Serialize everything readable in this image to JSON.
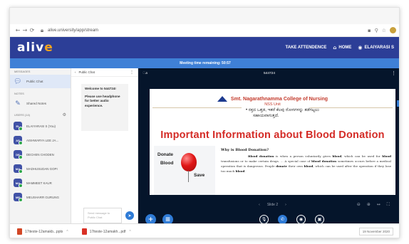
{
  "browser": {
    "url": "alive.university/app/stream"
  },
  "header": {
    "logo": "aliv",
    "logo_accent": "e",
    "take_attendance": "TAKE ATTENDENCE",
    "home": "HOME",
    "user": "ELAIYARASI S"
  },
  "timer": {
    "text": "Meeting time remaining: 50:57"
  },
  "sidebar": {
    "messages_label": "MESSAGES",
    "public_chat": "Public Chat",
    "notes_label": "NOTES",
    "shared_notes": "Shared Notes",
    "users_label": "USERS (14)",
    "users": [
      {
        "initials": "EL",
        "name": "ELAIYARASI S (You)"
      },
      {
        "initials": "AS",
        "name": "AISHWARYA LEE JA..."
      },
      {
        "initials": "DE",
        "name": "DECHEN CHODEN"
      },
      {
        "initials": "MA",
        "name": "MADHUSUDAN GOPI"
      },
      {
        "initials": "MA",
        "name": "MAMMEET KAUR"
      },
      {
        "initials": "ME",
        "name": "MEUSHARR GURUNG"
      }
    ]
  },
  "chat": {
    "title": "Public Chat",
    "welcome_1": "Welcome to 544724!",
    "welcome_2": "Please use headphone for better audio experience.",
    "input_placeholder": "Send message to Public Chat"
  },
  "presentation": {
    "meeting_title": "544724",
    "college": "Smt. Nagarathnamma College of Nursing",
    "unit": "NSS Unit",
    "kannada_1": "• ರಕ್ತದ ಒತ್ತಡ, ಇತರೆ ಕೆಲವು ರೋಗಗಳನ್ನು ತಡೆಗಟ್ಟಲು",
    "kannada_2": "ಸಹಾಯವಾಗುತ್ತದೆ.",
    "heading": "Important Information about Blood Donation",
    "img_word_1": "Donate",
    "img_word_2": "Blood",
    "img_word_3": "Save",
    "why_title": "Why is Blood Donation?",
    "para_1a": "Blood donation",
    "para_1b": " is when a person voluntarily gives ",
    "para_1c": "blood",
    "para_1d": ", which can be used for ",
    "para_2a": "blood",
    "para_2b": " transfusions or to make certain drugs. ... A special case of ",
    "para_2c": "blood donation",
    "para_2d": " sometimes occurs before a medical operation that is dangerous. People ",
    "para_2e": "donate",
    "para_2f": " their own ",
    "para_2g": "blood",
    "para_2h": ", which can be used after the operation if they lose too much ",
    "para_2i": "blood",
    "slide_label": "Slide 2"
  },
  "downloads": {
    "file_1": "17iteste-12amakb...pptx",
    "file_2": "17iteste-12amakh...pdf",
    "date": "19 November 2020"
  },
  "colors": {
    "header_bg": "#2c3e97",
    "timer_bg": "#3f80d6",
    "pres_bg": "#05152b",
    "accent": "#2f7bd6",
    "heading_red": "#d42b26"
  }
}
